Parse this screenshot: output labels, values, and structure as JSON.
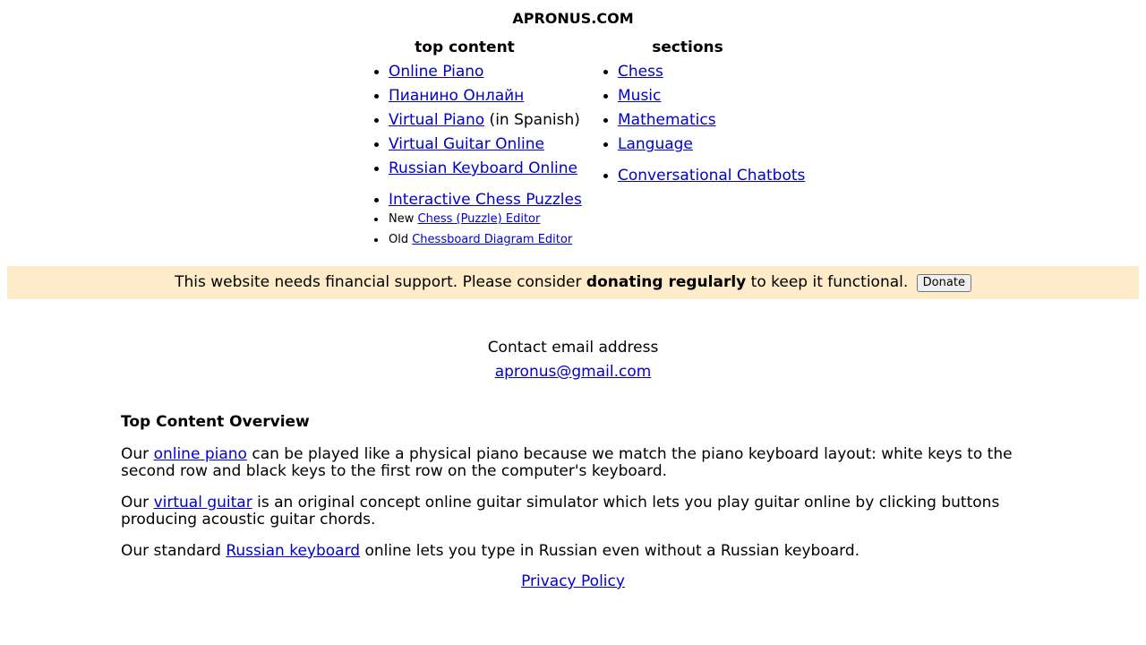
{
  "site_title": "APRONUS.COM",
  "top_content": {
    "heading": "top content",
    "items": [
      {
        "link": "Online Piano",
        "suffix": ""
      },
      {
        "link": "Пианино Онлайн",
        "suffix": ""
      },
      {
        "link": "Virtual Piano",
        "suffix": " (in Spanish)"
      },
      {
        "link": "Virtual Guitar Online",
        "suffix": ""
      },
      {
        "link": "Russian Keyboard Online",
        "suffix": ""
      },
      {
        "link": "Interactive Chess Puzzles",
        "suffix": ""
      }
    ],
    "sub_items": [
      {
        "prefix": "New ",
        "link": "Chess (Puzzle) Editor"
      },
      {
        "prefix": "Old ",
        "link": "Chessboard Diagram Editor"
      }
    ]
  },
  "sections": {
    "heading": "sections",
    "items": [
      "Chess",
      "Music",
      "Mathematics",
      "Language",
      "Conversational Chatbots"
    ]
  },
  "donate": {
    "text_before": "This website needs financial support. Please consider ",
    "text_bold": "donating regularly",
    "text_after": " to keep it functional.",
    "button_label": "Donate",
    "background_color": "#fdebc9"
  },
  "contact": {
    "label": "Contact email address",
    "email": "apronus@gmail.com"
  },
  "overview": {
    "heading": "Top Content Overview",
    "paragraphs": [
      {
        "before": "Our ",
        "link": "online piano",
        "after": " can be played like a physical piano because we match the piano keyboard layout: white keys to the second row and black keys to the first row on the computer's keyboard."
      },
      {
        "before": "Our ",
        "link": "virtual guitar",
        "after": " is an original concept online guitar simulator which lets you play guitar online by clicking buttons producing acoustic guitar chords."
      },
      {
        "before": "Our standard ",
        "link": "Russian keyboard",
        "after": " online lets you type in Russian even without a Russian keyboard."
      }
    ]
  },
  "privacy_link": "Privacy Policy",
  "colors": {
    "link": "#0000cc",
    "text": "#000000"
  }
}
